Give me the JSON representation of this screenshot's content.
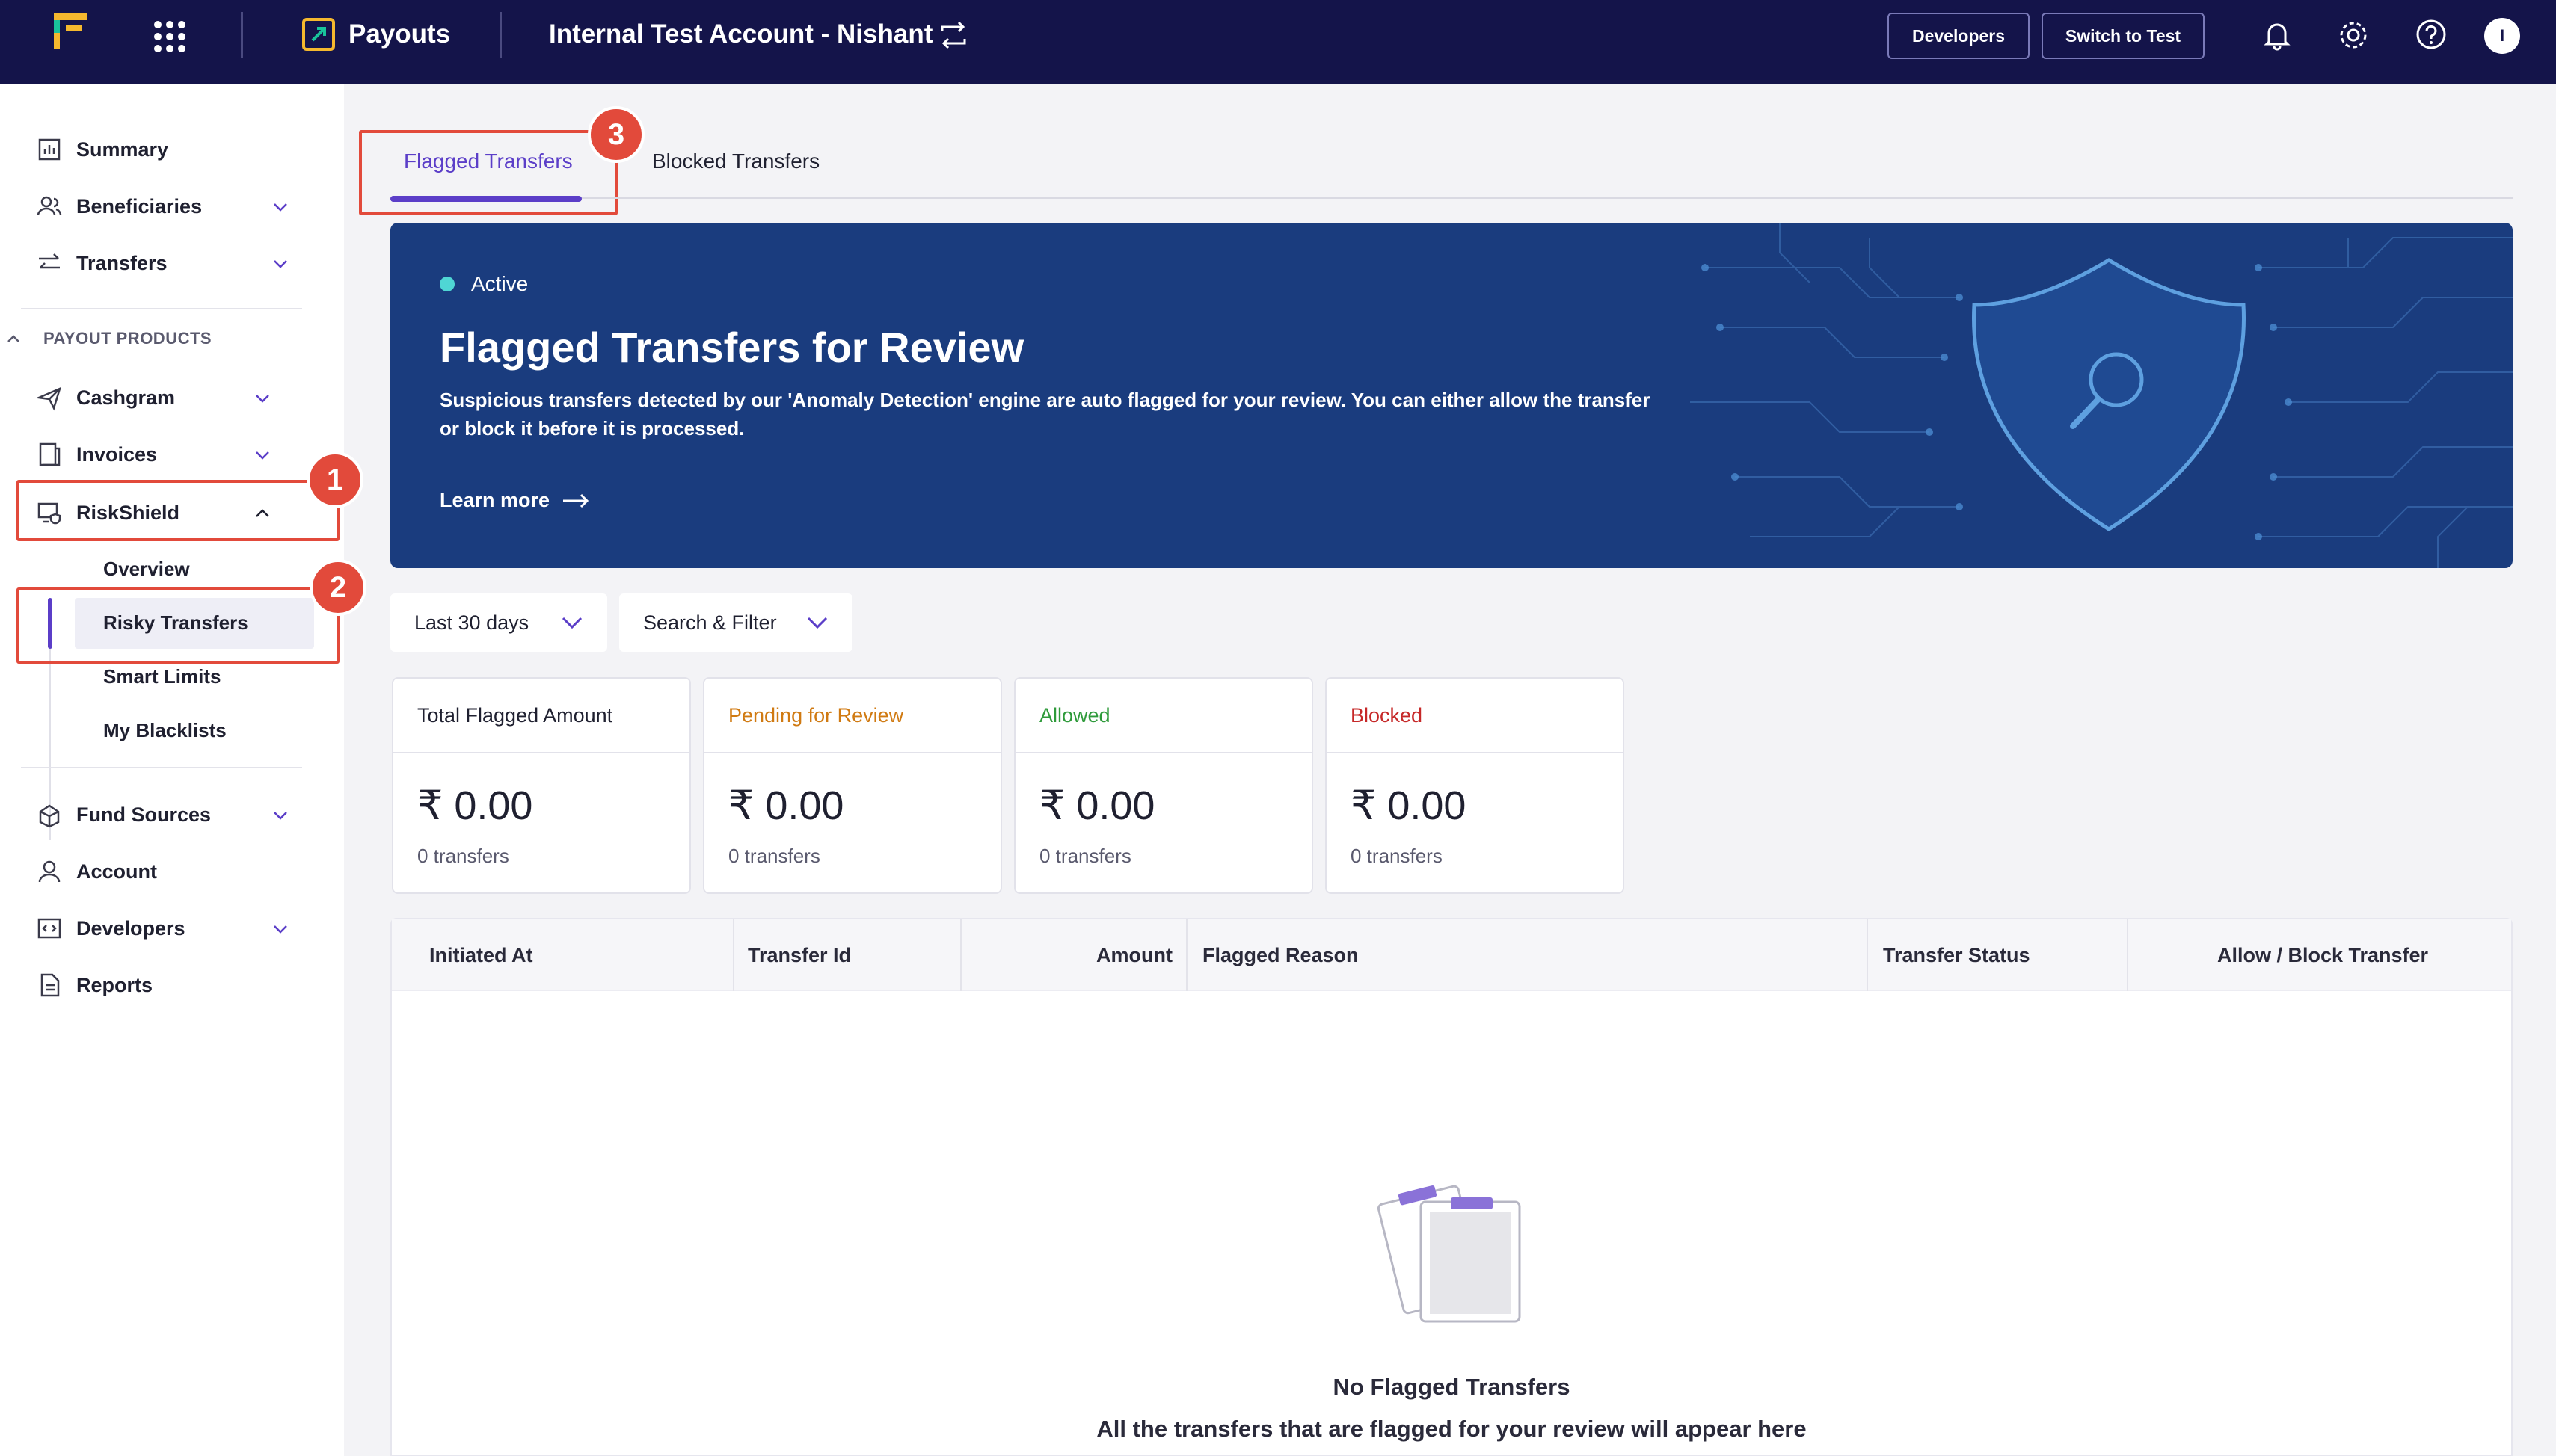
{
  "topbar": {
    "app_name": "Payouts",
    "account_name": "Internal Test Account - Nishant",
    "developers_label": "Developers",
    "switch_label": "Switch to Test",
    "avatar_initial": "I"
  },
  "sidebar": {
    "items": [
      {
        "label": "Summary",
        "icon": "chart-icon"
      },
      {
        "label": "Beneficiaries",
        "icon": "users-icon"
      },
      {
        "label": "Transfers",
        "icon": "transfer-icon"
      }
    ],
    "section_label": "PAYOUT PRODUCTS",
    "products": [
      {
        "label": "Cashgram",
        "icon": "send-icon"
      },
      {
        "label": "Invoices",
        "icon": "invoice-icon"
      },
      {
        "label": "RiskShield",
        "icon": "shield-monitor-icon"
      }
    ],
    "riskshield_sub": [
      {
        "label": "Overview"
      },
      {
        "label": "Risky Transfers"
      },
      {
        "label": "Smart Limits"
      },
      {
        "label": "My Blacklists"
      }
    ],
    "bottom": [
      {
        "label": "Fund Sources",
        "icon": "fund-icon"
      },
      {
        "label": "Account",
        "icon": "user-icon"
      },
      {
        "label": "Developers",
        "icon": "code-icon"
      },
      {
        "label": "Reports",
        "icon": "report-icon"
      }
    ]
  },
  "annotations": [
    "1",
    "2",
    "3"
  ],
  "tabs": [
    {
      "label": "Flagged Transfers"
    },
    {
      "label": "Blocked Transfers"
    }
  ],
  "banner": {
    "status": "Active",
    "title": "Flagged Transfers for Review",
    "description": "Suspicious transfers detected by our 'Anomaly Detection' engine are auto flagged for your review. You can either allow the transfer or block it before it is processed.",
    "link": "Learn more"
  },
  "filters": {
    "date": "Last 30 days",
    "search": "Search & Filter"
  },
  "stats": [
    {
      "label": "Total Flagged Amount",
      "value": "₹ 0.00",
      "sub": "0 transfers",
      "color": "#1f2030"
    },
    {
      "label": "Pending for Review",
      "value": "₹ 0.00",
      "sub": "0 transfers",
      "color": "#d07a12"
    },
    {
      "label": "Allowed",
      "value": "₹ 0.00",
      "sub": "0 transfers",
      "color": "#2e9a3a"
    },
    {
      "label": "Blocked",
      "value": "₹ 0.00",
      "sub": "0 transfers",
      "color": "#c62828"
    }
  ],
  "table": {
    "columns": [
      "Initiated At",
      "Transfer Id",
      "Amount",
      "Flagged Reason",
      "Transfer Status",
      "Allow / Block Transfer"
    ],
    "empty_title": "No Flagged Transfers",
    "empty_subtitle": "All the transfers that are flagged for your review will appear here"
  },
  "colors": {
    "topbar": "#14144a",
    "accent": "#5b3ec8",
    "banner": "#1a3c7e",
    "annotation": "#e24a3b"
  }
}
